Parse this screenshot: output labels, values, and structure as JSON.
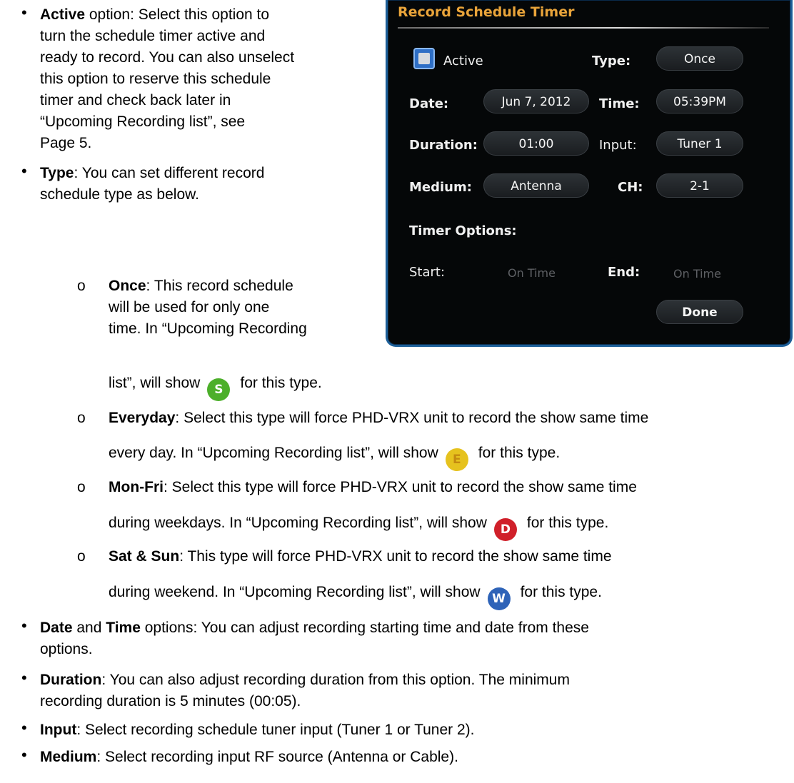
{
  "left_bullets": [
    {
      "bold": "Active",
      "rest": " option:  Select this option to"
    },
    {
      "bold": "Type",
      "rest": ": You can set different record"
    }
  ],
  "lines": {
    "active_2": "turn the schedule timer active and",
    "active_3": "ready to record. You can also unselect",
    "active_4": "this option to reserve this schedule",
    "active_5": "timer and check back later in",
    "active_6": "“Upcoming Recording list”, see",
    "active_7": "Page 5.",
    "type_2": "schedule type as below."
  },
  "once": {
    "marker": "o",
    "bold": "Once",
    "l1": ":  This record schedule",
    "l2": "will be used for only one",
    "l3": "time. In “Upcoming Recording",
    "l4a": "list”, will show",
    "l4b": "for this type.",
    "icon_letter": "S",
    "icon_color": "#4caf2a"
  },
  "everyday": {
    "marker": "o",
    "bold": "Everyday",
    "l1": ": Select this type will force PHD-VRX unit to record the show same time",
    "l2a": "every day. In “Upcoming Recording list”, will show",
    "l2b": "for this type.",
    "icon_letter": "E",
    "icon_color": "#e6c21e"
  },
  "monfri": {
    "marker": "o",
    "bold": "Mon-Fri",
    "l1": ": Select this type will force PHD-VRX unit to record the show same time",
    "l2a": "during weekdays. In “Upcoming Recording list”, will show",
    "l2b": "for this type.",
    "icon_letter": "D",
    "icon_color": "#d0202a"
  },
  "satsun": {
    "marker": "o",
    "bold": "Sat & Sun",
    "l1": ": This type will force PHD-VRX unit to record the show same time",
    "l2a": "during weekend. In “Upcoming Recording list”, will show",
    "l2b": "for this type.",
    "icon_letter": "W",
    "icon_color": "#2e63b8"
  },
  "bottom": {
    "date_b1": "Date",
    "date_mid": " and ",
    "date_b2": "Time",
    "date_rest": " options: You can adjust recording starting time and date from these",
    "date_l2": "options.",
    "duration_b": "Duration",
    "duration_rest": ": You can also adjust recording duration from this option. The minimum",
    "duration_l2": "recording duration is 5 minutes (00:05).",
    "input_b": "Input",
    "input_rest": ": Select recording schedule tuner input (Tuner 1 or Tuner 2).",
    "medium_b": "Medium",
    "medium_rest": ": Select recording input RF source (Antenna or Cable)."
  },
  "panel": {
    "title": "Record Schedule Timer",
    "active_label": "Active",
    "type_label": "Type:",
    "type_value": "Once",
    "date_label": "Date:",
    "date_value": "Jun 7, 2012",
    "time_label": "Time:",
    "time_value": "05:39PM",
    "duration_label": "Duration:",
    "duration_value": "01:00",
    "input_label": "Input:",
    "input_value": "Tuner 1",
    "medium_label": "Medium:",
    "medium_value": "Antenna",
    "ch_label": "CH:",
    "ch_value": "2-1",
    "timer_options_label": "Timer Options:",
    "start_label": "Start:",
    "start_value": "On Time",
    "end_label": "End:",
    "end_value": "On Time",
    "done_label": "Done",
    "accent_color": "#e9a43a",
    "border_color": "#1d5f98"
  },
  "bullet_char": "•"
}
